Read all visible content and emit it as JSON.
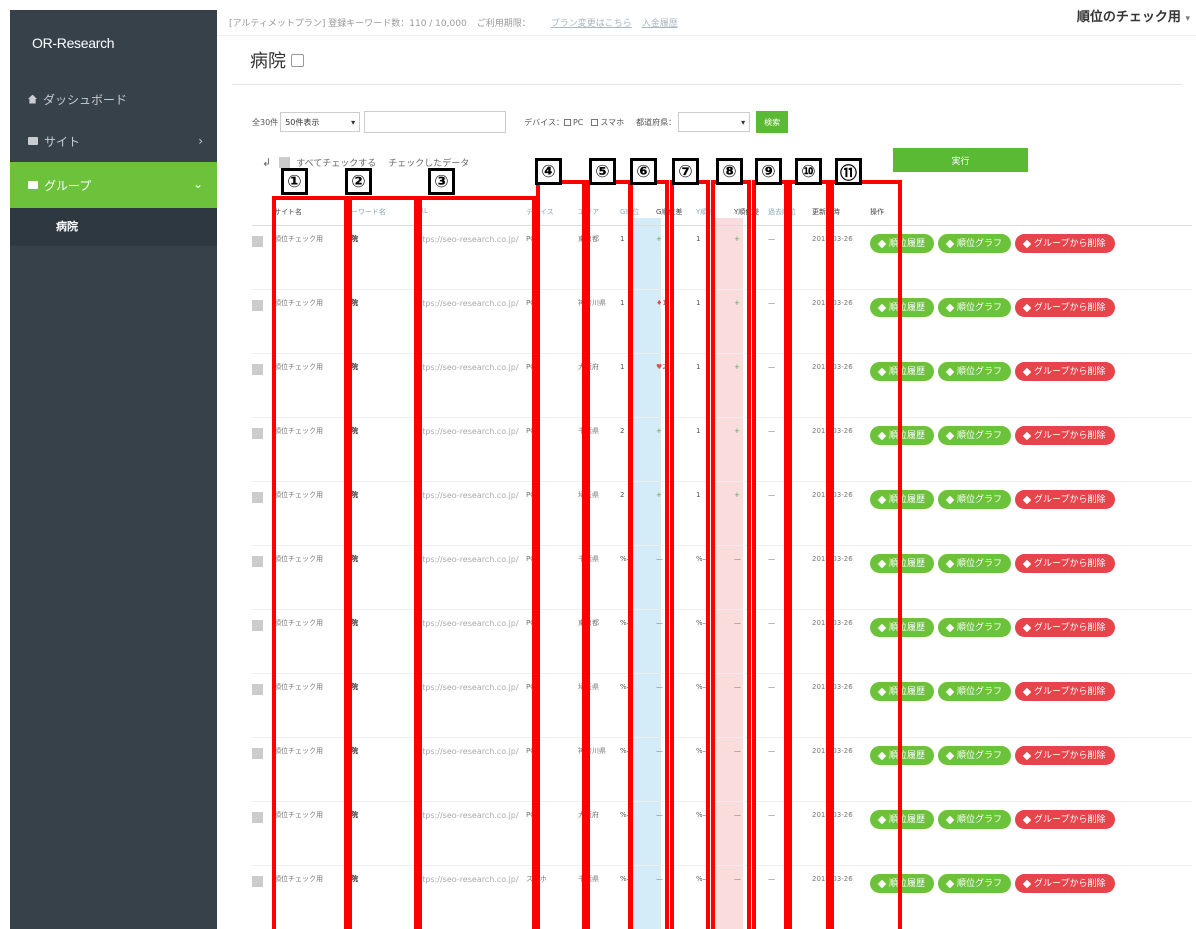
{
  "sidebar": {
    "brand": "OR-Research",
    "items": [
      {
        "label": "ダッシュボード"
      },
      {
        "label": "サイト"
      },
      {
        "label": "グループ"
      }
    ],
    "sub_item": "病院"
  },
  "topbar": {
    "plan": "[アルティメットプラン] 登録キーワード数：110 / 10,000",
    "expiry": "ご利用期限：",
    "link1": "プラン変更はこちら",
    "link2": "入金履歴",
    "user": "順位のチェック用"
  },
  "page": {
    "title": "病院"
  },
  "filters": {
    "count": "全30件",
    "per_page": "50件表示",
    "device_label": "デバイス：",
    "pc": "PC",
    "sp": "スマホ",
    "pref_label": "都道府県：",
    "search_btn": "検索"
  },
  "bulk": {
    "check_all": "すべてチェックする",
    "checked": "チェックしたデータ",
    "execute": "実行"
  },
  "table": {
    "headers": {
      "site": "サイト名",
      "keyword": "キーワード名",
      "url": "URL",
      "device": "デバイス",
      "area": "エリア",
      "grank": "G順位",
      "gchg": "G順位差",
      "yrank": "Y順位",
      "ychg": "Y順位差",
      "past": "過去順位",
      "date": "更新日時",
      "ops": "操作"
    },
    "rows": [
      {
        "site": "順位チェック用",
        "kw": "病院",
        "url": "https://seo-research.co.jp/",
        "dev": "PC",
        "area": "東京都",
        "g": "1",
        "gc": "+",
        "y": "1",
        "yc": "+",
        "past": "—",
        "date": "2018-03-26"
      },
      {
        "site": "順位チェック用",
        "kw": "病院",
        "url": "https://seo-research.co.jp/",
        "dev": "PC",
        "area": "神奈川県",
        "g": "1",
        "gc": "♦1",
        "y": "1",
        "yc": "+",
        "past": "—",
        "date": "2018-03-26"
      },
      {
        "site": "順位チェック用",
        "kw": "病院",
        "url": "https://seo-research.co.jp/",
        "dev": "PC",
        "area": "大阪府",
        "g": "1",
        "gc": "♥2",
        "y": "1",
        "yc": "+",
        "past": "—",
        "date": "2018-03-26"
      },
      {
        "site": "順位チェック用",
        "kw": "病院",
        "url": "https://seo-research.co.jp/",
        "dev": "PC",
        "area": "千葉県",
        "g": "2",
        "gc": "+",
        "y": "1",
        "yc": "+",
        "past": "—",
        "date": "2018-03-26"
      },
      {
        "site": "順位チェック用",
        "kw": "病院",
        "url": "https://seo-research.co.jp/",
        "dev": "PC",
        "area": "埼玉県",
        "g": "2",
        "gc": "+",
        "y": "1",
        "yc": "+",
        "past": "—",
        "date": "2018-03-26"
      },
      {
        "site": "順位チェック用",
        "kw": "病院",
        "url": "https://seo-research.co.jp/",
        "dev": "PC",
        "area": "千葉県",
        "g": "%—",
        "gc": "—",
        "y": "%—",
        "yc": "—",
        "past": "—",
        "date": "2018-03-26"
      },
      {
        "site": "順位チェック用",
        "kw": "病院",
        "url": "https://seo-research.co.jp/",
        "dev": "PC",
        "area": "東京都",
        "g": "%—",
        "gc": "—",
        "y": "%—",
        "yc": "—",
        "past": "—",
        "date": "2018-03-26"
      },
      {
        "site": "順位チェック用",
        "kw": "病院",
        "url": "https://seo-research.co.jp/",
        "dev": "PC",
        "area": "埼玉県",
        "g": "%—",
        "gc": "—",
        "y": "%—",
        "yc": "—",
        "past": "—",
        "date": "2018-03-26"
      },
      {
        "site": "順位チェック用",
        "kw": "病院",
        "url": "https://seo-research.co.jp/",
        "dev": "PC",
        "area": "神奈川県",
        "g": "%—",
        "gc": "—",
        "y": "%—",
        "yc": "—",
        "past": "—",
        "date": "2018-03-26"
      },
      {
        "site": "順位チェック用",
        "kw": "病院",
        "url": "https://seo-research.co.jp/",
        "dev": "PC",
        "area": "大阪府",
        "g": "%—",
        "gc": "—",
        "y": "%—",
        "yc": "—",
        "past": "—",
        "date": "2018-03-26"
      },
      {
        "site": "順位チェック用",
        "kw": "病院",
        "url": "https://seo-research.co.jp/",
        "dev": "スマホ",
        "area": "千葉県",
        "g": "%—",
        "gc": "—",
        "y": "%—",
        "yc": "—",
        "past": "—",
        "date": "2018-03-26"
      }
    ],
    "ops": {
      "history": "順位履歴",
      "graph": "順位グラフ",
      "remove": "グループから削除"
    }
  },
  "annotations": [
    "①",
    "②",
    "③",
    "④",
    "⑤",
    "⑥",
    "⑦",
    "⑧",
    "⑨",
    "⑩",
    "⑪"
  ],
  "colors": {
    "accent": "#6cc23a",
    "sidebar": "#36414a",
    "danger": "#e8424a",
    "frame": "#ff0000"
  }
}
